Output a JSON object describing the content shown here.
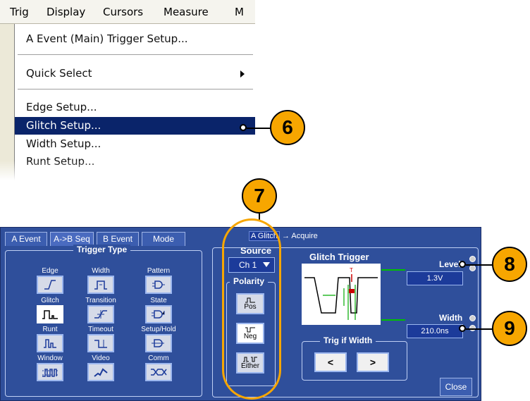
{
  "menu": {
    "menubar": [
      "Trig",
      "Display",
      "Cursors",
      "Measure",
      "M"
    ],
    "items": [
      {
        "label": "A Event (Main) Trigger Setup..."
      },
      {
        "label": "Quick Select",
        "submenu": true
      },
      {
        "label": "Edge Setup..."
      },
      {
        "label": "Glitch Setup...",
        "selected": true
      },
      {
        "label": "Width Setup..."
      },
      {
        "label": "Runt Setup..."
      }
    ]
  },
  "callouts": [
    "6",
    "7",
    "8",
    "9"
  ],
  "panel": {
    "tabs": [
      "A Event",
      "A->B Seq",
      "B Event",
      "Mode"
    ],
    "breadcrumb": {
      "current": "A Glitch",
      "next": "Acquire"
    },
    "trigger_type": {
      "title": "Trigger Type",
      "types": [
        "Edge",
        "Width",
        "Pattern",
        "Glitch",
        "Transition",
        "State",
        "Runt",
        "Timeout",
        "Setup/Hold",
        "Window",
        "Video",
        "Comm"
      ],
      "selected": "Glitch"
    },
    "source": {
      "title": "Source",
      "value": "Ch 1"
    },
    "polarity": {
      "title": "Polarity",
      "options": [
        "Pos",
        "Neg",
        "Either"
      ],
      "selected": "Neg"
    },
    "glitch_trigger": {
      "title": "Glitch Trigger"
    },
    "level": {
      "label": "Level",
      "value": "1.3V"
    },
    "width": {
      "label": "Width",
      "value": "210.0ns"
    },
    "trig_if_width": {
      "title": "Trig if Width",
      "options": [
        "<",
        ">"
      ]
    },
    "close": "Close"
  },
  "colors": {
    "accent": "#f7a600",
    "panel": "#2f4f9b",
    "menu_selected": "#0a246a"
  }
}
